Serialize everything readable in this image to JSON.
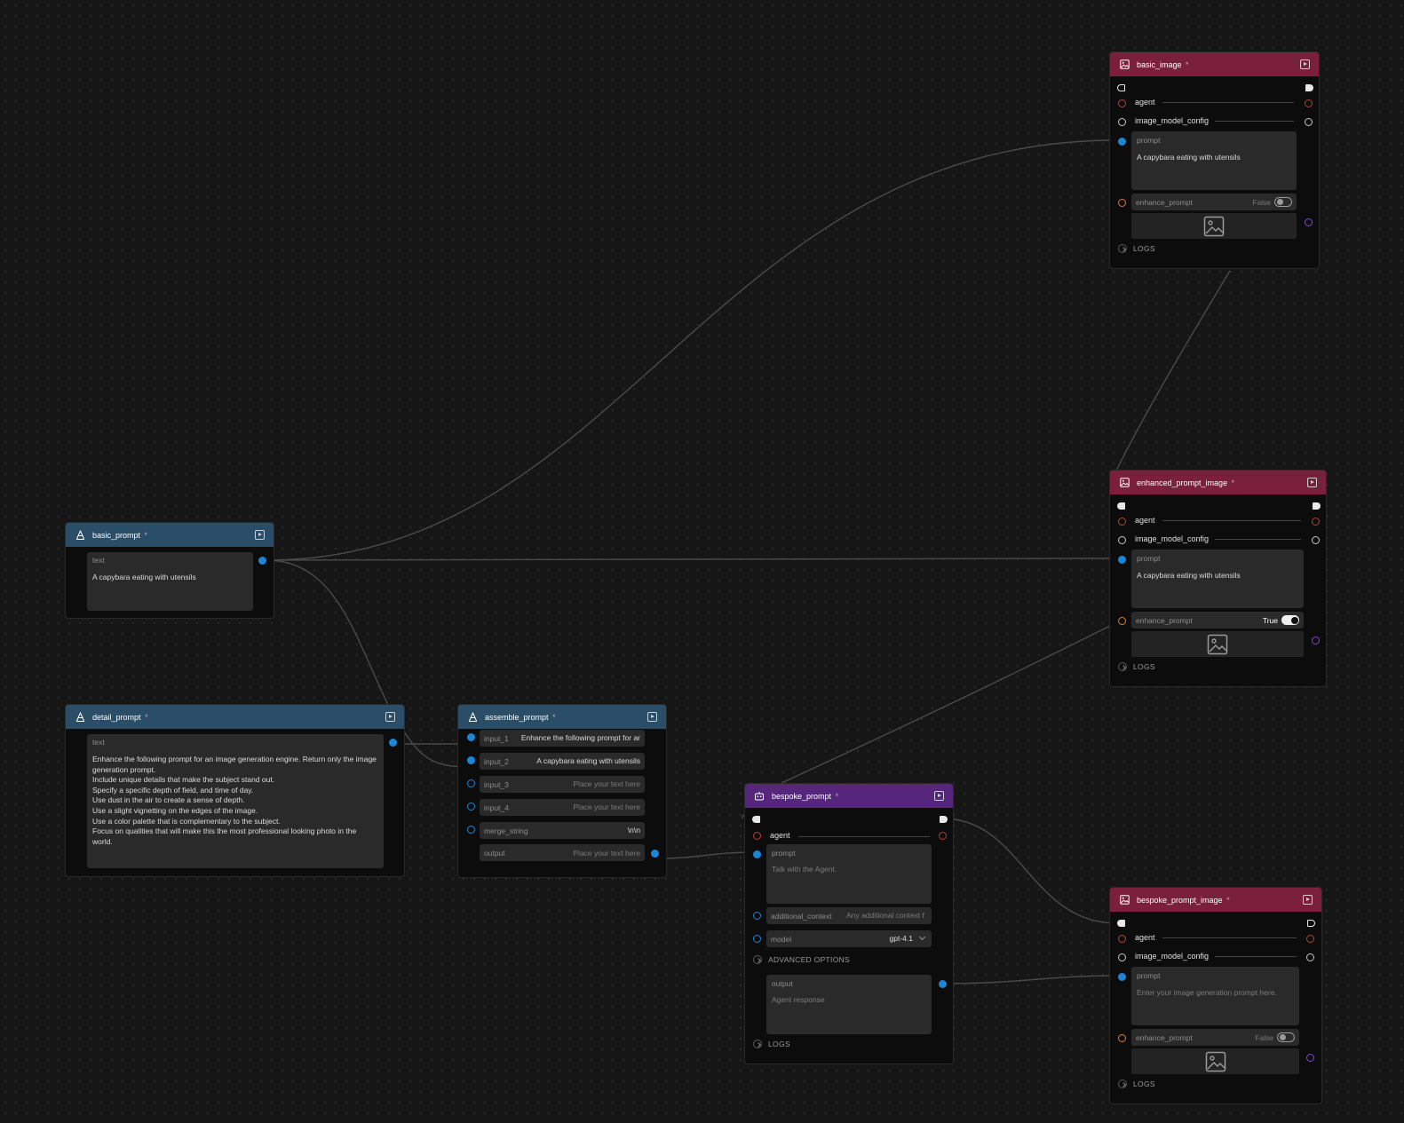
{
  "colors": {
    "canvas_bg": "#161616",
    "header_text_node": "#2a4d68",
    "header_image_node": "#7a1f3c",
    "header_agent_node": "#55267c",
    "port_text": "#1b86d6",
    "port_agent": "#b8412e",
    "port_bool": "#e07b27",
    "port_image": "#8a43d9"
  },
  "nodes": {
    "basic_prompt": {
      "title": "basic_prompt",
      "star": "*",
      "icon": "text-icon",
      "text_label": "text",
      "text_value": "A capybara eating with utensils"
    },
    "detail_prompt": {
      "title": "detail_prompt",
      "star": "*",
      "icon": "text-icon",
      "text_label": "text",
      "text_lines": [
        "Enhance the following prompt for an image generation engine. Return only the image",
        "generation prompt.",
        "Include unique details that make the subject stand out.",
        "Specify a specific depth of field, and time of day.",
        "Use dust in the air to create a sense of depth.",
        "Use a slight vignetting on the edges of the image.",
        "Use a color palette that is complementary to the subject.",
        "Focus on qualities that will make this the most professional looking photo in the",
        "world."
      ]
    },
    "assemble_prompt": {
      "title": "assemble_prompt",
      "star": "*",
      "icon": "text-icon",
      "input_1": {
        "label": "input_1",
        "value": "Enhance the following prompt for ar"
      },
      "input_2": {
        "label": "input_2",
        "value": "A capybara eating with utensils"
      },
      "input_3": {
        "label": "input_3",
        "placeholder": "Place your text here"
      },
      "input_4": {
        "label": "input_4",
        "placeholder": "Place your text here"
      },
      "merge_string": {
        "label": "merge_string",
        "value": "\\n\\n"
      },
      "output": {
        "label": "output",
        "placeholder": "Place your text here"
      }
    },
    "bespoke_prompt": {
      "title": "bespoke_prompt",
      "star": "*",
      "icon": "robot-icon",
      "agent_label": "agent",
      "prompt_label": "prompt",
      "prompt_placeholder": "Talk with the Agent.",
      "additional_context_label": "additional_context",
      "additional_context_placeholder": "Any additional context f",
      "model_label": "model",
      "model_value": "gpt-4.1",
      "advanced_options": "ADVANCED OPTIONS",
      "output_label": "output",
      "output_placeholder": "Agent response",
      "logs": "LOGS"
    },
    "basic_image": {
      "title": "basic_image",
      "star": "*",
      "icon": "image-icon",
      "agent_label": "agent",
      "config_label": "image_model_config",
      "prompt_label": "prompt",
      "prompt_value": "A capybara eating with utensils",
      "enhance_label": "enhance_prompt",
      "enhance_value": "False",
      "enhance_on": 0,
      "logs": "LOGS"
    },
    "enhanced_prompt_image": {
      "title": "enhanced_prompt_image",
      "star": "*",
      "icon": "image-icon",
      "agent_label": "agent",
      "config_label": "image_model_config",
      "prompt_label": "prompt",
      "prompt_value": "A capybara eating with utensils",
      "enhance_label": "enhance_prompt",
      "enhance_value": "True",
      "enhance_on": 1,
      "logs": "LOGS"
    },
    "bespoke_prompt_image": {
      "title": "bespoke_prompt_image",
      "star": "*",
      "icon": "image-icon",
      "agent_label": "agent",
      "config_label": "image_model_config",
      "prompt_label": "prompt",
      "prompt_placeholder": "Enter your image generation prompt here.",
      "enhance_label": "enhance_prompt",
      "enhance_value": "False",
      "enhance_on": 0,
      "logs": "LOGS"
    }
  }
}
